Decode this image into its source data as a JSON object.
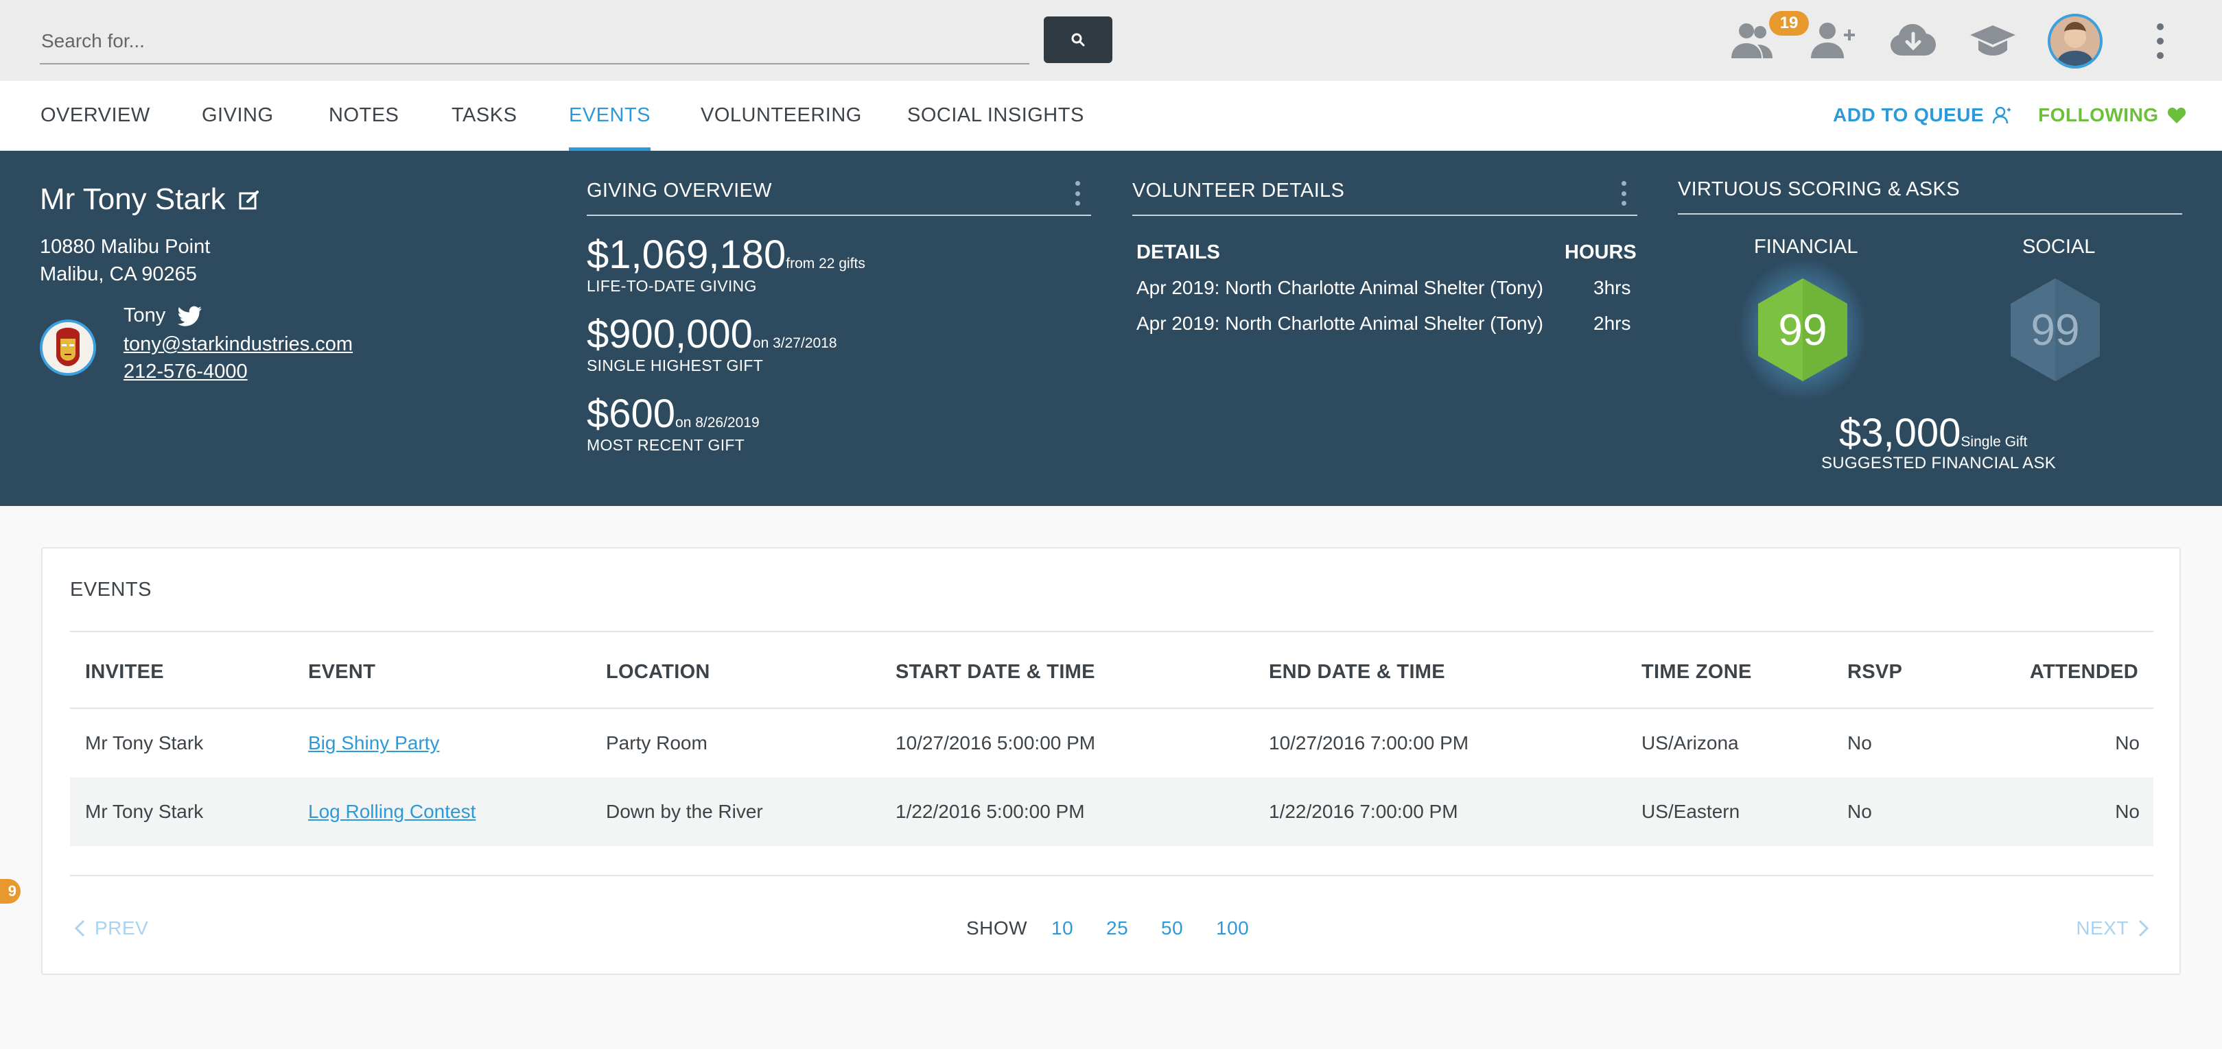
{
  "search": {
    "placeholder": "Search for..."
  },
  "topbar": {
    "notifications_count": "19"
  },
  "nav": {
    "tabs": [
      {
        "label": "OVERVIEW"
      },
      {
        "label": "GIVING"
      },
      {
        "label": "NOTES"
      },
      {
        "label": "TASKS"
      },
      {
        "label": "EVENTS",
        "active": true
      },
      {
        "label": "VOLUNTEERING"
      },
      {
        "label": "SOCIAL INSIGHTS"
      }
    ],
    "add_to_queue": "ADD TO QUEUE",
    "following": "FOLLOWING"
  },
  "profile": {
    "name": "Mr Tony Stark",
    "address_line1": "10880 Malibu Point",
    "address_line2": "Malibu, CA 90265",
    "contact_name": "Tony",
    "email": "tony@starkindustries.com",
    "phone": "212-576-4000"
  },
  "giving_overview": {
    "title": "GIVING OVERVIEW",
    "items": [
      {
        "amount": "$1,069,180",
        "note": "from 22 gifts",
        "label": "LIFE-TO-DATE GIVING"
      },
      {
        "amount": "$900,000",
        "note": "on 3/27/2018",
        "label": "SINGLE HIGHEST GIFT"
      },
      {
        "amount": "$600",
        "note": "on 8/26/2019",
        "label": "MOST RECENT GIFT"
      }
    ]
  },
  "volunteer": {
    "title": "VOLUNTEER DETAILS",
    "col_details": "DETAILS",
    "col_hours": "HOURS",
    "rows": [
      {
        "detail": "Apr 2019: North Charlotte Animal Shelter (Tony)",
        "hours": "3hrs"
      },
      {
        "detail": "Apr 2019: North Charlotte Animal Shelter (Tony)",
        "hours": "2hrs"
      }
    ]
  },
  "scoring": {
    "title": "VIRTUOUS SCORING & ASKS",
    "financial_label": "FINANCIAL",
    "financial_score": "99",
    "social_label": "SOCIAL",
    "social_score": "99",
    "ask_amount": "$3,000",
    "ask_note": "Single Gift",
    "ask_label": "SUGGESTED FINANCIAL ASK",
    "colors": {
      "financial": "#7dc142",
      "social": "#4d6f8a"
    }
  },
  "events": {
    "title": "EVENTS",
    "columns": [
      "INVITEE",
      "EVENT",
      "LOCATION",
      "START DATE & TIME",
      "END DATE & TIME",
      "TIME ZONE",
      "RSVP",
      "ATTENDED"
    ],
    "rows": [
      {
        "invitee": "Mr Tony Stark",
        "event": "Big Shiny Party",
        "location": "Party Room",
        "start": "10/27/2016 5:00:00 PM",
        "end": "10/27/2016 7:00:00 PM",
        "tz": "US/Arizona",
        "rsvp": "No",
        "attended": "No"
      },
      {
        "invitee": "Mr Tony Stark",
        "event": "Log Rolling Contest",
        "location": "Down by the River",
        "start": "1/22/2016 5:00:00 PM",
        "end": "1/22/2016 7:00:00 PM",
        "tz": "US/Eastern",
        "rsvp": "No",
        "attended": "No"
      }
    ],
    "pager": {
      "prev": "PREV",
      "show": "SHOW",
      "sizes": [
        "10",
        "25",
        "50",
        "100"
      ],
      "next": "NEXT"
    }
  },
  "side_badge": "9",
  "accent": "#2c9ad9",
  "following_color": "#6cbf3b"
}
